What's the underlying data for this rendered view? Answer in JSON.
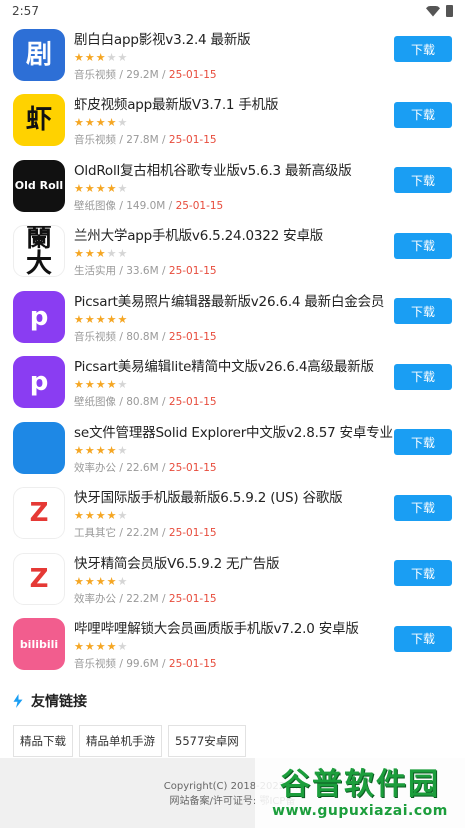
{
  "status_bar": {
    "time": "2:57"
  },
  "colors": {
    "accent": "#1a9ef3",
    "star": "#f5a623",
    "date": "#e74c3c"
  },
  "download_label": "下载",
  "apps": [
    {
      "name": "剧白白app影视v3.2.4 最新版",
      "rating": 3,
      "category": "音乐视频",
      "size": "29.2M",
      "date": "25-01-15",
      "icon": "jubaibai-icon",
      "icon_text": "剧",
      "icon_bg": "#2d6fd6"
    },
    {
      "name": "虾皮视频app最新版V3.7.1 手机版",
      "rating": 4,
      "category": "音乐视频",
      "size": "27.8M",
      "date": "25-01-15",
      "icon": "xiapi-icon",
      "icon_text": "虾",
      "icon_bg": "#ffd200"
    },
    {
      "name": "OldRoll复古相机谷歌专业版v5.6.3 最新高级版",
      "rating": 4,
      "category": "壁纸图像",
      "size": "149.0M",
      "date": "25-01-15",
      "icon": "oldroll-icon",
      "icon_text": "Old Roll",
      "icon_bg": "#111111"
    },
    {
      "name": "兰州大学app手机版v6.5.24.0322 安卓版",
      "rating": 3,
      "category": "生活实用",
      "size": "33.6M",
      "date": "25-01-15",
      "icon": "lzu-icon",
      "icon_text": "蘭大",
      "icon_bg": "#ffffff"
    },
    {
      "name": "Picsart美易照片编辑器最新版v26.6.4 最新白金会员",
      "rating": 5,
      "category": "音乐视频",
      "size": "80.8M",
      "date": "25-01-15",
      "icon": "picsart-icon",
      "icon_text": "p",
      "icon_bg": "#8a3df2"
    },
    {
      "name": "Picsart美易编辑lite精简中文版v26.6.4高级最新版",
      "rating": 4,
      "category": "壁纸图像",
      "size": "80.8M",
      "date": "25-01-15",
      "icon": "picsart-lite-icon",
      "icon_text": "p",
      "icon_bg": "#8a3df2"
    },
    {
      "name": "se文件管理器Solid Explorer中文版v2.8.57 安卓专业",
      "rating": 4,
      "category": "效率办公",
      "size": "22.6M",
      "date": "25-01-15",
      "icon": "solid-explorer-icon",
      "icon_text": "",
      "icon_bg": "#1e88e5"
    },
    {
      "name": "快牙国际版手机版最新版6.5.9.2 (US) 谷歌版",
      "rating": 4,
      "category": "工具其它",
      "size": "22.2M",
      "date": "25-01-15",
      "icon": "zapya-icon",
      "icon_text": "Z",
      "icon_bg": "#ffffff"
    },
    {
      "name": "快牙精简会员版V6.5.9.2 无广告版",
      "rating": 4,
      "category": "效率办公",
      "size": "22.2M",
      "date": "25-01-15",
      "icon": "zapya-lite-icon",
      "icon_text": "Z",
      "icon_bg": "#ffffff"
    },
    {
      "name": "哔哩哔哩解锁大会员画质版手机版v7.2.0 安卓版",
      "rating": 4,
      "category": "音乐视频",
      "size": "99.6M",
      "date": "25-01-15",
      "icon": "bilibili-icon",
      "icon_text": "bilibili",
      "icon_bg": "#f25d8e"
    }
  ],
  "friend_links": {
    "title": "友情链接",
    "items": [
      "精品下载",
      "精品单机手游",
      "5577安卓网"
    ]
  },
  "footer": {
    "copyright": "Copyright(C) 2018-2022 m.",
    "icp": "网站备案/许可证号: 鄂ICP备"
  },
  "watermark": {
    "title": "谷普软件园",
    "url": "www.gupuxiazai.com"
  }
}
